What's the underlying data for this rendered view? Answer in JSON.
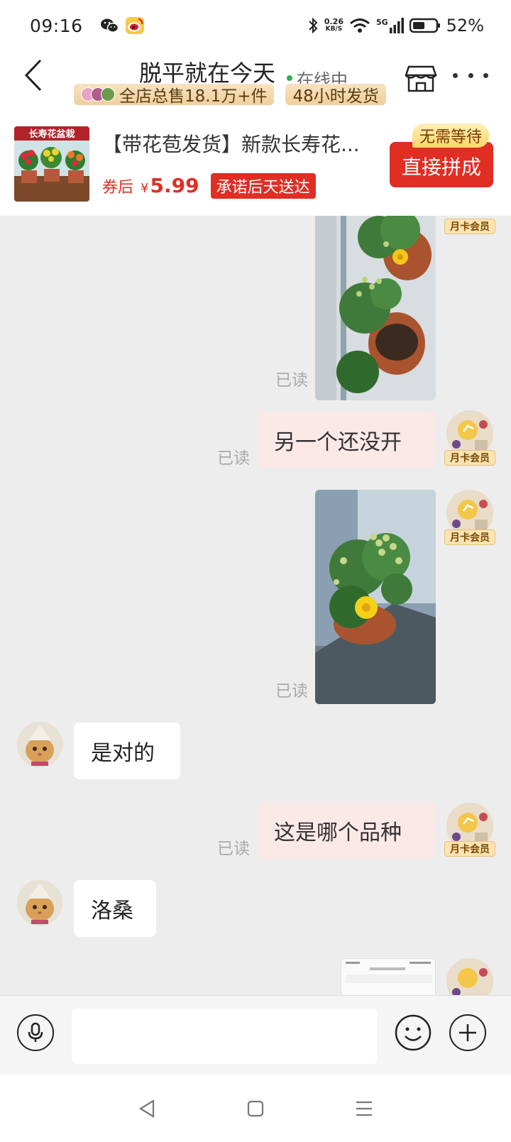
{
  "status_bar": {
    "time": "09:16",
    "app_icons": [
      "wechat-icon",
      "weibo-icon"
    ],
    "net_speed_value": "0.26",
    "net_speed_unit": "KB/S",
    "signal_label": "5G",
    "battery": "52%"
  },
  "header": {
    "shop_name": "脱平就在今天",
    "online_status": "在线中",
    "tag_sales": "全店总售18.1万+件",
    "tag_shipping": "48小时发货"
  },
  "product": {
    "image_caption": "长寿花盆栽",
    "title": "【带花苞发货】新款长寿花...",
    "coupon_label": "券后",
    "currency": "¥",
    "price": "5.99",
    "promise": "承诺后天送达",
    "no_wait_badge": "无需等待",
    "buy_button": "直接拼成"
  },
  "chat": {
    "member_label": "月卡会员",
    "read_label": "已读",
    "messages": [
      {
        "from": "me",
        "type": "image"
      },
      {
        "from": "me",
        "type": "text",
        "text": "另一个还没开"
      },
      {
        "from": "me",
        "type": "image"
      },
      {
        "from": "them",
        "type": "text",
        "text": "是对的"
      },
      {
        "from": "me",
        "type": "text",
        "text": "这是哪个品种"
      },
      {
        "from": "them",
        "type": "text",
        "text": "洛桑"
      },
      {
        "from": "me",
        "type": "image"
      }
    ]
  },
  "input_bar": {
    "placeholder": ""
  },
  "colors": {
    "brand_red": "#e02e24",
    "my_bubble": "#fbe9e8",
    "chat_bg": "#ededed",
    "online_green": "#2cb34a"
  }
}
